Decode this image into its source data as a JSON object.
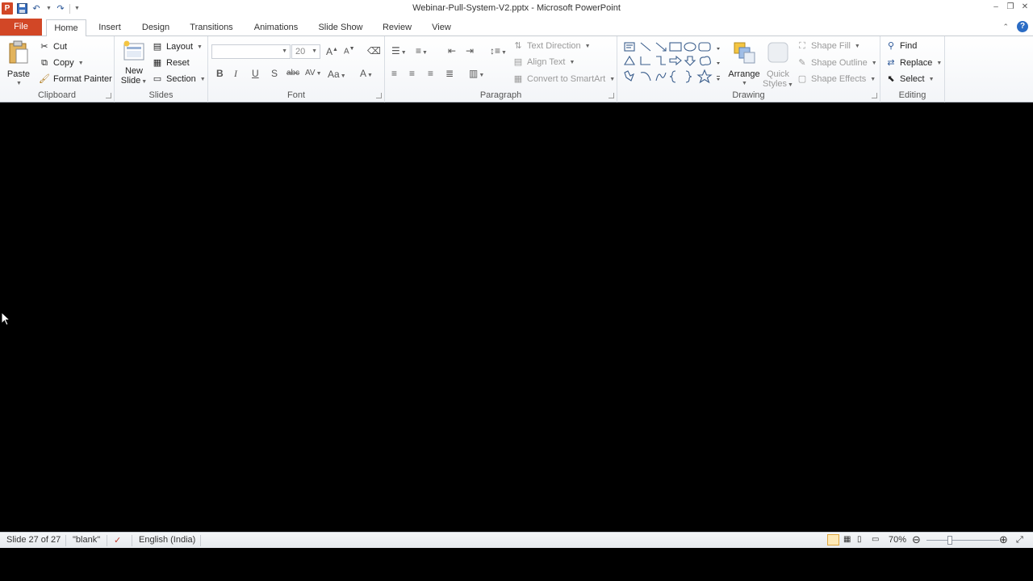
{
  "window": {
    "title": "Webinar-Pull-System-V2.pptx  -  Microsoft PowerPoint",
    "app_logo": "P"
  },
  "tabs": [
    {
      "label": "File"
    },
    {
      "label": "Home"
    },
    {
      "label": "Insert"
    },
    {
      "label": "Design"
    },
    {
      "label": "Transitions"
    },
    {
      "label": "Animations"
    },
    {
      "label": "Slide Show"
    },
    {
      "label": "Review"
    },
    {
      "label": "View"
    }
  ],
  "clipboard": {
    "paste": "Paste",
    "cut": "Cut",
    "copy": "Copy",
    "format_painter": "Format Painter",
    "label": "Clipboard"
  },
  "slides": {
    "new_slide_line1": "New",
    "new_slide_line2": "Slide",
    "layout": "Layout",
    "reset": "Reset",
    "section": "Section",
    "label": "Slides"
  },
  "font": {
    "font_name": "",
    "font_size": "20",
    "label": "Font"
  },
  "paragraph": {
    "text_direction": "Text Direction",
    "align_text": "Align Text",
    "convert_smartart": "Convert to SmartArt",
    "label": "Paragraph"
  },
  "drawing": {
    "arrange": "Arrange",
    "quick_styles_line1": "Quick",
    "quick_styles_line2": "Styles",
    "shape_fill": "Shape Fill",
    "shape_outline": "Shape Outline",
    "shape_effects": "Shape Effects",
    "label": "Drawing"
  },
  "editing": {
    "find": "Find",
    "replace": "Replace",
    "select": "Select",
    "label": "Editing"
  },
  "status": {
    "slide_info": "Slide 27 of 27",
    "theme": "\"blank\"",
    "language": "English (India)",
    "zoom": "70%"
  }
}
